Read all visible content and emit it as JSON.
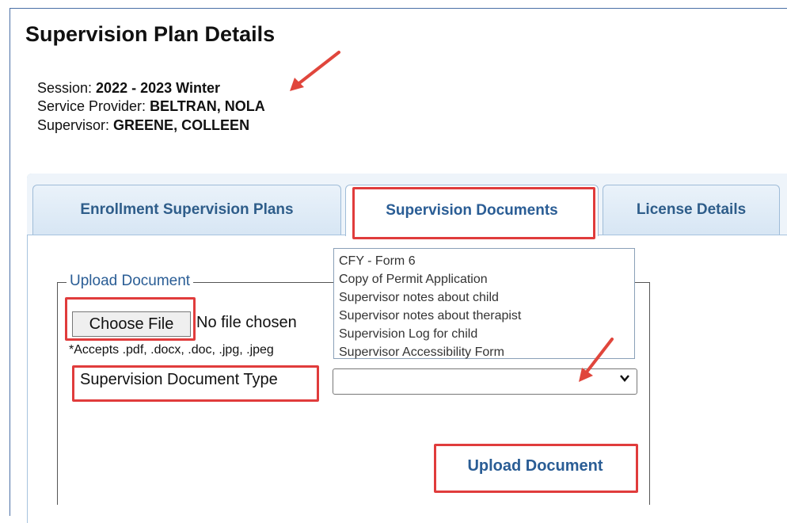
{
  "page": {
    "title": "Supervision Plan Details"
  },
  "info": {
    "session_label": "Session: ",
    "session_value": "2022 - 2023 Winter",
    "provider_label": "Service Provider: ",
    "provider_value": "BELTRAN, NOLA",
    "supervisor_label": "Supervisor: ",
    "supervisor_value": "GREENE, COLLEEN"
  },
  "tabs": [
    {
      "label": "Enrollment Supervision Plans"
    },
    {
      "label": "Supervision Documents",
      "active": true
    },
    {
      "label": "License Details"
    }
  ],
  "upload": {
    "legend": "Upload Document",
    "choose_file_label": "Choose File",
    "no_file_text": "No file chosen",
    "accepts_text": "*Accepts .pdf, .docx, .doc, .jpg, .jpeg",
    "doc_type_label": "Supervision Document Type",
    "doc_type_value": "",
    "options": [
      "CFY - Form 6",
      "Copy of Permit Application",
      "Supervisor notes about child",
      "Supervisor notes about therapist",
      "Supervision Log for child",
      "Supervisor Accessibility Form"
    ],
    "upload_button_label": "Upload Document"
  },
  "colors": {
    "highlight": "#e03c3c",
    "link_blue": "#2a5d95",
    "tab_bg": "#d7e6f4"
  }
}
